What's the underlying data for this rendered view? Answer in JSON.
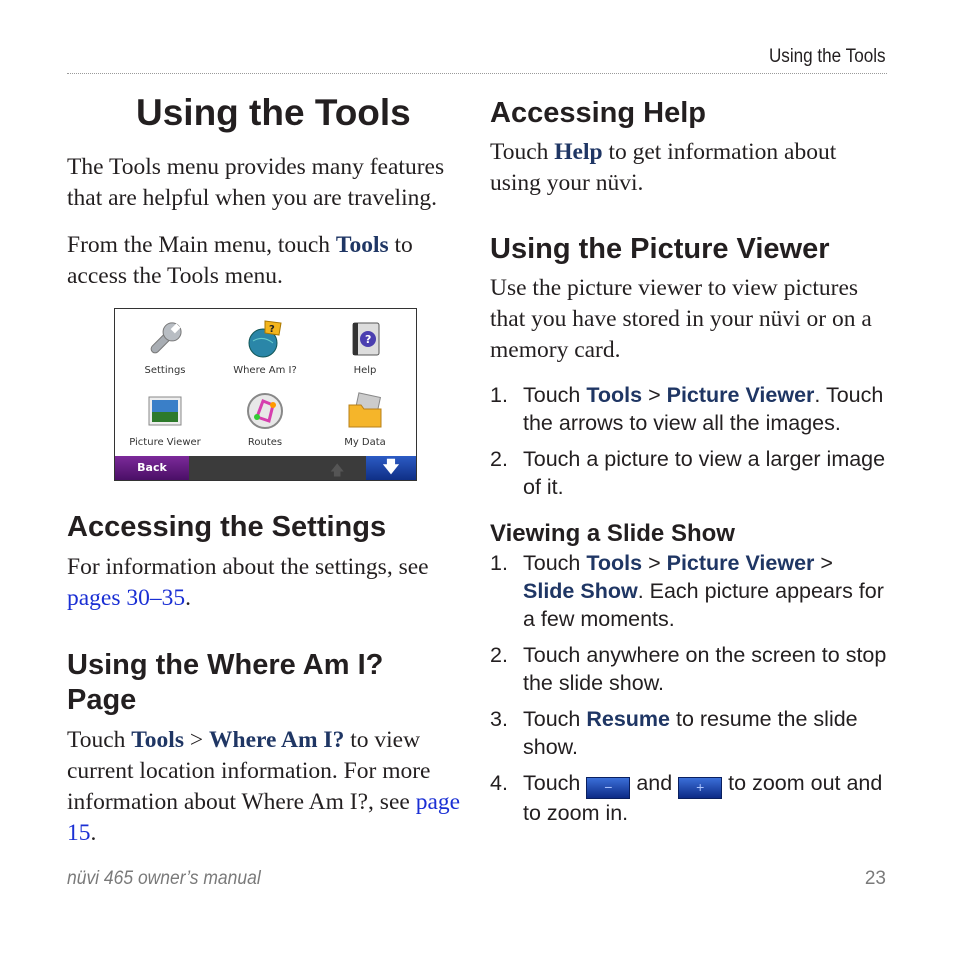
{
  "header": {
    "running_title": "Using the Tools"
  },
  "left": {
    "title": "Using the Tools",
    "intro": "The Tools menu provides many features that are helpful when you are traveling.",
    "main_menu": {
      "pre": "From the Main menu, touch ",
      "bold": "Tools",
      "post": " to access the Tools menu."
    },
    "device": {
      "tiles": [
        {
          "label": "Settings",
          "icon": "wrench-icon"
        },
        {
          "label": "Where Am I?",
          "icon": "globe-flag-icon"
        },
        {
          "label": "Help",
          "icon": "help-book-icon"
        },
        {
          "label": "Picture Viewer",
          "icon": "picture-icon"
        },
        {
          "label": "Routes",
          "icon": "routes-icon"
        },
        {
          "label": "My Data",
          "icon": "folder-icon"
        }
      ],
      "back_label": "Back",
      "up_icon": "arrow-up-icon",
      "down_icon": "arrow-down-icon"
    },
    "settings": {
      "heading": "Accessing the Settings",
      "text": "For information about the settings, see ",
      "link": "pages 30–35",
      "end": "."
    },
    "where": {
      "heading_line1": "Using the Where Am I?",
      "heading_line2": "Page",
      "pre": "Touch ",
      "b1": "Tools",
      "sep": " > ",
      "b2": "Where Am I?",
      "post": " to view current location information. For more information about Where Am I?, see ",
      "link": "page 15",
      "end": "."
    }
  },
  "right": {
    "help": {
      "heading": "Accessing Help",
      "pre": "Touch ",
      "bold": "Help",
      "post": " to get information about using your nüvi."
    },
    "picture": {
      "heading": "Using the Picture Viewer",
      "text": "Use the picture viewer to view pictures that you have stored in your nüvi or on a memory card.",
      "steps": [
        {
          "num": "1.",
          "pre": "Touch ",
          "b1": "Tools",
          "sep": " > ",
          "b2": "Picture Viewer",
          "post": ". Touch the arrows to view all the images."
        },
        {
          "num": "2.",
          "text": "Touch a picture to view a larger image of it."
        }
      ]
    },
    "slideshow": {
      "heading": "Viewing a Slide Show",
      "steps": [
        {
          "num": "1.",
          "pre": "Touch ",
          "b1": "Tools",
          "sep1": " > ",
          "b2": "Picture Viewer",
          "sep2": " > ",
          "b3": "Slide Show",
          "post": ". Each picture appears for a few moments."
        },
        {
          "num": "2.",
          "text": "Touch anywhere on the screen to stop the slide show."
        },
        {
          "num": "3.",
          "pre": "Touch ",
          "bold": "Resume",
          "post": " to resume the slide show."
        },
        {
          "num": "4.",
          "pre": "Touch ",
          "mid": " and ",
          "post": " to zoom out and to zoom in.",
          "minus_icon": "zoom-out-icon",
          "plus_icon": "zoom-in-icon"
        }
      ]
    }
  },
  "footer": {
    "manual": "nüvi 465 owner’s manual",
    "page": "23"
  }
}
